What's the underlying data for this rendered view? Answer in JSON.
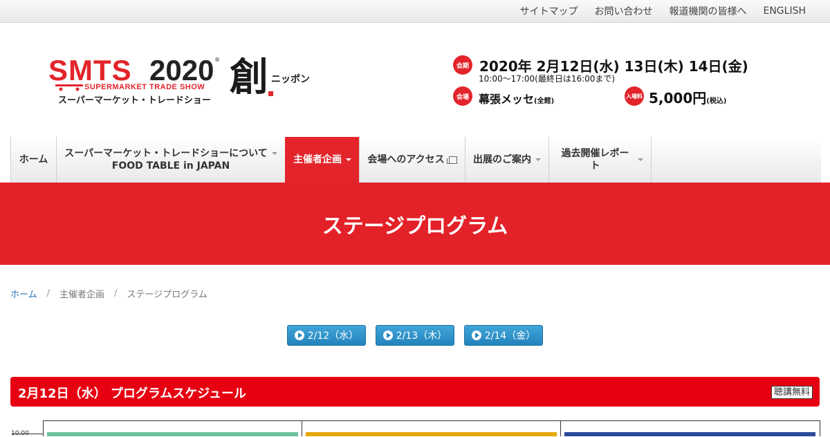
{
  "top_links": [
    "サイトマップ",
    "お問い合わせ",
    "報道機関の皆様へ",
    "ENGLISH"
  ],
  "logo": {
    "smts": "SMTS",
    "year": "2020",
    "reg": "®",
    "subtitle_en": "SUPERMARKET TRADE SHOW",
    "subtitle_jp": "スーパーマーケット・トレードショー",
    "sou": "創",
    "nippon": "ニッポン"
  },
  "event": {
    "period_badge": "会期",
    "dates": "2020年 2月12日(水) 13日(木) 14日(金)",
    "hours": "10:00〜17:00(最終日は16:00まで)",
    "venue_badge": "会場",
    "venue": "幕張メッセ",
    "venue_note": "(全館)",
    "fee_badge": "入場料",
    "fee": "5,000円",
    "fee_note": "(税込)"
  },
  "nav": {
    "home": "ホーム",
    "about_line1": "スーパーマーケット・トレードショーについて",
    "about_line2": "FOOD TABLE in JAPAN",
    "organizer": "主催者企画",
    "access": "会場へのアクセス",
    "exhibit": "出展のご案内",
    "reports": "過去開催レポート"
  },
  "hero_title": "ステージプログラム",
  "breadcrumb": {
    "home": "ホーム",
    "parent": "主催者企画",
    "current": "ステージプログラム",
    "sep": "/"
  },
  "day_buttons": [
    "2/12（水）",
    "2/13（木）",
    "2/14（金）"
  ],
  "schedule": {
    "title": "2月12日（水） プログラムスケジュール",
    "free_label": "聴講無料",
    "first_time": "10:00",
    "stage_colors": [
      "#6cc19b",
      "#e6a80b",
      "#2b4a9a"
    ]
  },
  "colors": {
    "accent": "#e3242b",
    "button": "#2a8fca"
  }
}
